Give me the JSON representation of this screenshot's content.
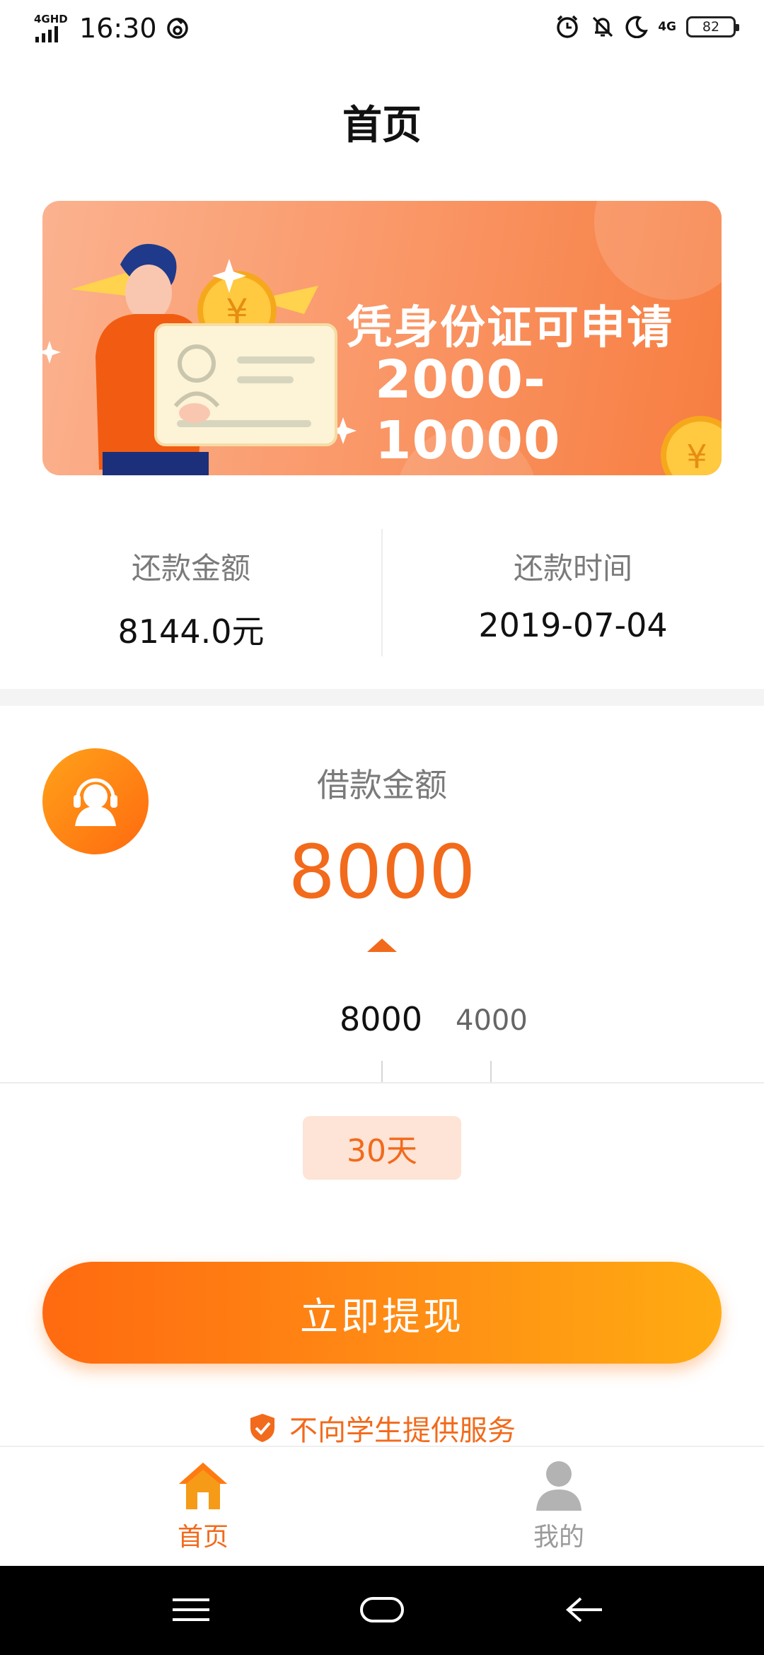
{
  "status_bar": {
    "network_label": "4GHD",
    "time": "16:30",
    "cellular_label": "4G",
    "battery": "82"
  },
  "header": {
    "title": "首页"
  },
  "banner": {
    "line1": "凭身份证可申请",
    "line2": "2000-10000",
    "colors": {
      "start": "#fbb28f",
      "end": "#f77d40"
    }
  },
  "repayment": {
    "amount_label": "还款金额",
    "amount_value": "8144.0元",
    "date_label": "还款时间",
    "date_value": "2019-07-04"
  },
  "loan": {
    "label": "借款金额",
    "amount": "8000",
    "scale_values": [
      "8000",
      "4000"
    ],
    "term": "30天",
    "cta": "立即提现",
    "notice": "不向学生提供服务"
  },
  "tabbar": {
    "items": [
      {
        "label": "首页",
        "icon": "home-icon",
        "active": true
      },
      {
        "label": "我的",
        "icon": "user-icon",
        "active": false
      }
    ]
  },
  "colors": {
    "accent": "#f26a1b",
    "cta_start": "#ff6a10",
    "cta_end": "#ffab12",
    "chip_bg": "#fde4d6"
  }
}
